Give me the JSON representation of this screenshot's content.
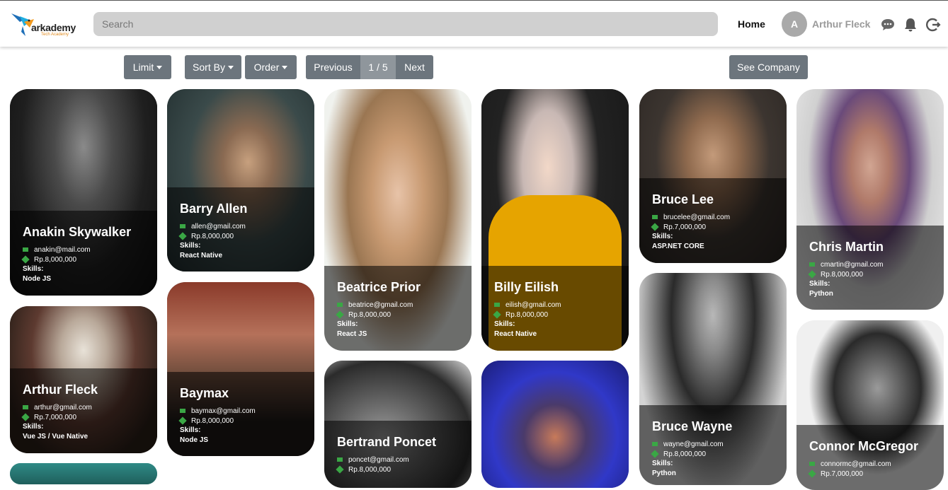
{
  "brand": {
    "name": "arkademy",
    "tagline": "Tech Academy"
  },
  "search": {
    "placeholder": "Search"
  },
  "nav": {
    "home": "Home"
  },
  "user": {
    "initial": "A",
    "name": "Arthur Fleck"
  },
  "toolbar": {
    "limit": "Limit",
    "sort_by": "Sort By",
    "order": "Order",
    "previous": "Previous",
    "page": "1 / 5",
    "next": "Next",
    "see_company": "See Company"
  },
  "skills_label": "Skills:",
  "cards": [
    {
      "name": "Anakin Skywalker",
      "email": "anakin@mail.com",
      "salary": "Rp.8,000,000",
      "skill": "Node JS"
    },
    {
      "name": "Arthur Fleck",
      "email": "arthur@gmail.com",
      "salary": "Rp.7,000,000",
      "skill": "Vue JS / Vue Native"
    },
    {
      "name": "Barry Allen",
      "email": "allen@gmail.com",
      "salary": "Rp.8,000,000",
      "skill": "React Native"
    },
    {
      "name": "Baymax",
      "email": "baymax@gmail.com",
      "salary": "Rp.8,000,000",
      "skill": "Node JS"
    },
    {
      "name": "Beatrice Prior",
      "email": "beatrice@gmail.com",
      "salary": "Rp.8,000,000",
      "skill": "React JS"
    },
    {
      "name": "Bertrand Poncet",
      "email": "poncet@gmail.com",
      "salary": "Rp.8,000,000",
      "skill": ""
    },
    {
      "name": "Billy Eilish",
      "email": "eilish@gmail.com",
      "salary": "Rp.8,000,000",
      "skill": "React Native"
    },
    {
      "name": "Bruce Lee",
      "email": "brucelee@gmail.com",
      "salary": "Rp.7,000,000",
      "skill": "ASP.NET CORE"
    },
    {
      "name": "Bruce Wayne",
      "email": "wayne@gmail.com",
      "salary": "Rp.8,000,000",
      "skill": "Python"
    },
    {
      "name": "Chris Martin",
      "email": "cmartin@gmail.com",
      "salary": "Rp.8,000,000",
      "skill": "Python"
    },
    {
      "name": "Connor McGregor",
      "email": "connormc@gmail.com",
      "salary": "Rp.7,000,000",
      "skill": ""
    }
  ],
  "colors": {
    "button": "#6c757d",
    "search_bg": "#d0d0d0",
    "accent_green": "#3aa745"
  }
}
